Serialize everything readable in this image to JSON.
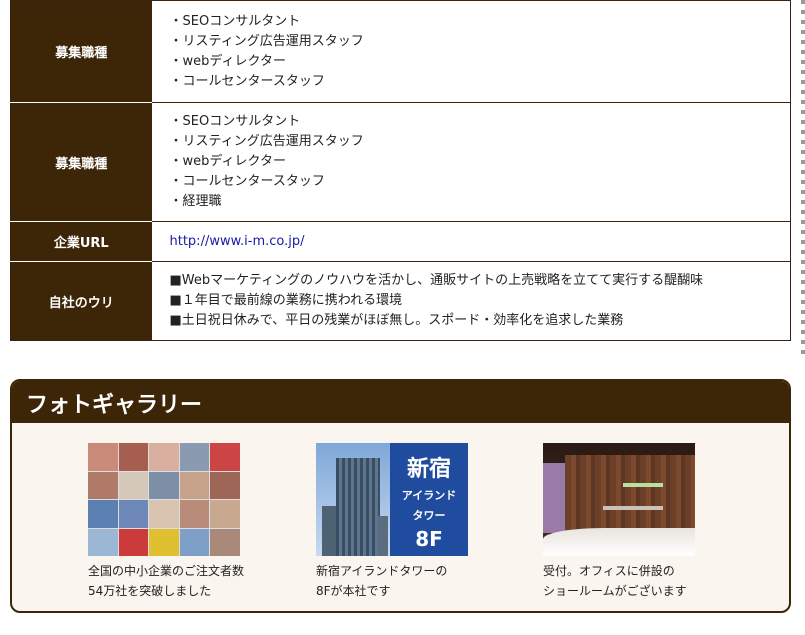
{
  "info_table": {
    "rows": [
      {
        "label": "募集職種",
        "lines": [
          "・SEOコンサルタント",
          "・リスティング広告運用スタッフ",
          "・webディレクター",
          "・コールセンタースタッフ"
        ]
      },
      {
        "label": "募集職種",
        "lines": [
          "・SEOコンサルタント",
          "・リスティング広告運用スタッフ",
          "・webディレクター",
          "・コールセンタースタッフ",
          "・経理職"
        ]
      },
      {
        "label": "企業URL",
        "url": "http://www.i-m.co.jp/"
      },
      {
        "label": "自社のウリ",
        "lines": [
          "■Webマーケティングのノウハウを活かし、通販サイトの上売戦略を立てて実行する醍醐味",
          "■１年目で最前線の業務に携われる環境",
          "■土日祝日休みで、平日の残業がほぼ無し。スポード・効率化を追求した業務"
        ]
      }
    ]
  },
  "gallery": {
    "title": "フォトギャラリー",
    "photos": [
      {
        "icon": "staff-collage-photo",
        "caption_lines": [
          "全国の中小企業のご注文者数",
          "54万社を突破しました"
        ]
      },
      {
        "icon": "building-photo",
        "panel": {
          "line1": "新宿",
          "line2": "アイランド",
          "line3": "タワー",
          "line4": "8F"
        },
        "caption_lines": [
          "新宿アイランドタワーの",
          "8Fが本社です"
        ]
      },
      {
        "icon": "reception-photo",
        "caption_lines": [
          "受付。オフィスに併設の",
          "ショールームがございます"
        ]
      }
    ]
  },
  "colors": {
    "header_bg": "#3d2508",
    "link": "#1a1aa6",
    "gallery_bg": "#fbf5ef"
  }
}
